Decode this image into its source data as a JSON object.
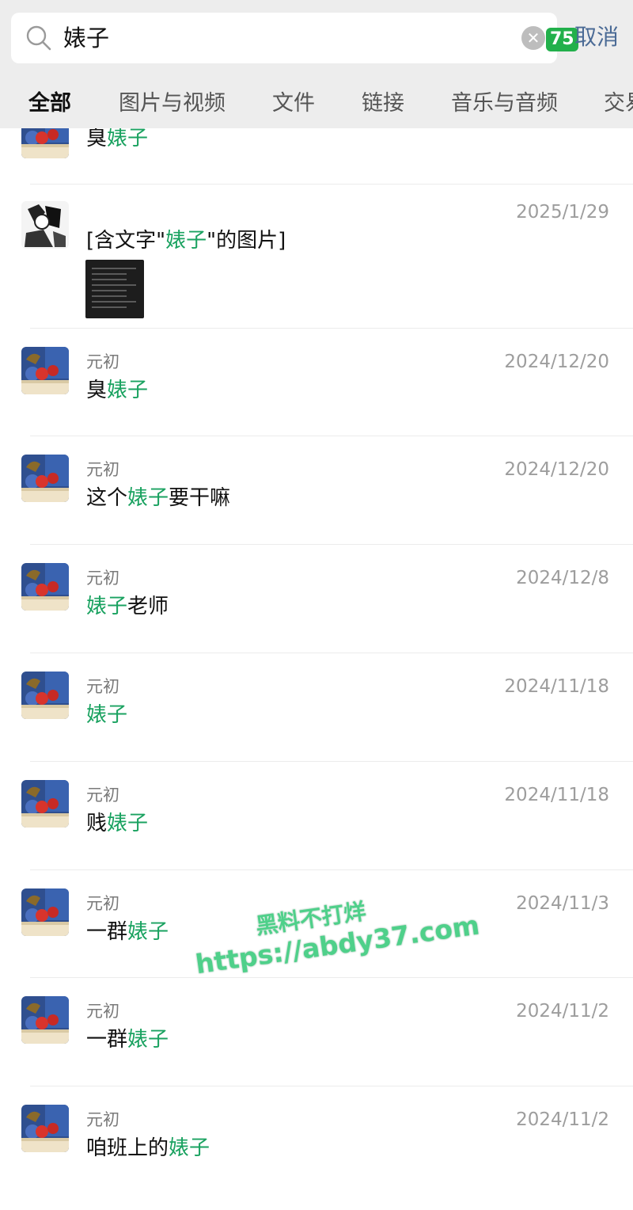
{
  "search": {
    "query": "婊子",
    "badge": "75",
    "cancel_label": "取消"
  },
  "tabs": [
    "全部",
    "图片与视频",
    "文件",
    "链接",
    "音乐与音频",
    "交易"
  ],
  "results": [
    {
      "sender": "",
      "date": "",
      "parts": [
        {
          "t": "臭"
        },
        {
          "t": "婊子",
          "h": true
        }
      ]
    },
    {
      "sender": "",
      "date": "2025/1/29",
      "parts": [
        {
          "t": "[含文字\""
        },
        {
          "t": "婊子",
          "h": true
        },
        {
          "t": "\"的图片]"
        }
      ],
      "has_thumb": true
    },
    {
      "sender": "元初",
      "date": "2024/12/20",
      "parts": [
        {
          "t": "臭"
        },
        {
          "t": "婊子",
          "h": true
        }
      ]
    },
    {
      "sender": "元初",
      "date": "2024/12/20",
      "parts": [
        {
          "t": "这个"
        },
        {
          "t": "婊子",
          "h": true
        },
        {
          "t": "要干嘛"
        }
      ]
    },
    {
      "sender": "元初",
      "date": "2024/12/8",
      "parts": [
        {
          "t": "婊子",
          "h": true
        },
        {
          "t": "老师"
        }
      ]
    },
    {
      "sender": "元初",
      "date": "2024/11/18",
      "parts": [
        {
          "t": "婊子",
          "h": true
        }
      ]
    },
    {
      "sender": "元初",
      "date": "2024/11/18",
      "parts": [
        {
          "t": "贱"
        },
        {
          "t": "婊子",
          "h": true
        }
      ]
    },
    {
      "sender": "元初",
      "date": "2024/11/3",
      "parts": [
        {
          "t": "一群"
        },
        {
          "t": "婊子",
          "h": true
        }
      ]
    },
    {
      "sender": "元初",
      "date": "2024/11/2",
      "parts": [
        {
          "t": "一群"
        },
        {
          "t": "婊子",
          "h": true
        }
      ]
    },
    {
      "sender": "元初",
      "date": "2024/11/2",
      "parts": [
        {
          "t": "咱班上的"
        },
        {
          "t": "婊子",
          "h": true
        }
      ]
    }
  ],
  "watermark": {
    "line1": "黑料不打烊",
    "line2": "https://abdy37.com"
  },
  "colors": {
    "highlight": "#1aa260",
    "cancel": "#4a6a95",
    "badge": "#22b04b",
    "topbar": "#ededed"
  },
  "icons": [
    "search-icon",
    "clear-icon",
    "avatar"
  ]
}
